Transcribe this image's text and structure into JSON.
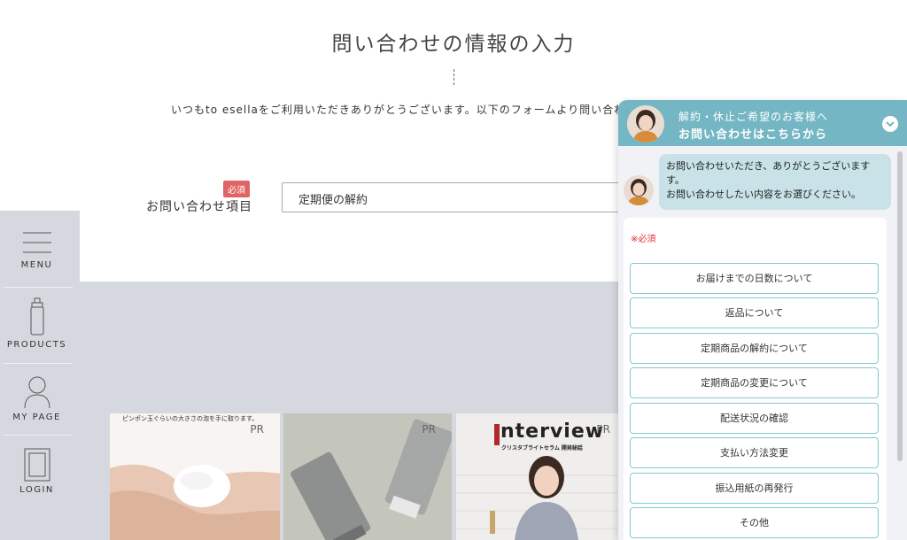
{
  "form": {
    "title": "問い合わせの情報の入力",
    "intro": "いつもto esellaをご利用いただきありがとうございます。以下のフォームより問い合わせ",
    "required_badge": "必須",
    "field_label": "お問い合わせ項目",
    "select_value": "定期便の解約"
  },
  "side_nav": {
    "menu": "MENU",
    "products": "PRODUCTS",
    "my_page": "MY PAGE",
    "login": "LOGIN"
  },
  "cards": [
    {
      "pr": "PR",
      "caption": "ピンポン玉ぐらいの大きさの泡を手に取ります。"
    },
    {
      "pr": "PR"
    },
    {
      "pr": "PR",
      "headline": "nterview",
      "subhead": "クリスタブライトセラム 開発秘話"
    }
  ],
  "chat": {
    "header_line1": "解約・休止ご希望のお客様へ",
    "header_line2": "お問い合わせはこちらから",
    "message_line1": "お問い合わせいただき、ありがとうございます",
    "message_line2": "す。",
    "message_line3": "お問い合わせしたい内容をお選びください。",
    "required_note": "※必須",
    "options": [
      "お届けまでの日数について",
      "返品について",
      "定期商品の解約について",
      "定期商品の変更について",
      "配送状況の確認",
      "支払い方法変更",
      "振込用紙の再発行",
      "その他"
    ]
  },
  "colors": {
    "chat_header": "#74b6c3",
    "chat_bubble": "#c8e2e8",
    "option_border": "#85c9cf",
    "required_red": "#e16464",
    "gray_bg": "#d6d8e0"
  }
}
